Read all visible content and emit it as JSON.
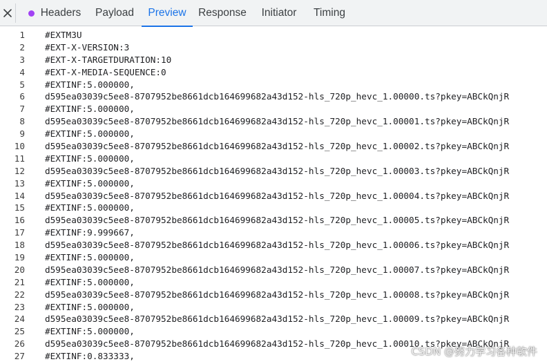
{
  "colors": {
    "accent": "#1a73e8",
    "headers_dot": "#a142f4",
    "tabbar_bg": "#f1f3f4"
  },
  "tabs": [
    {
      "label": "Headers",
      "icon": "status-dot-icon",
      "active": false
    },
    {
      "label": "Payload",
      "active": false
    },
    {
      "label": "Preview",
      "active": true
    },
    {
      "label": "Response",
      "active": false
    },
    {
      "label": "Initiator",
      "active": false
    },
    {
      "label": "Timing",
      "active": false
    }
  ],
  "lines": [
    {
      "n": "1",
      "t": "#EXTM3U"
    },
    {
      "n": "2",
      "t": "#EXT-X-VERSION:3"
    },
    {
      "n": "3",
      "t": "#EXT-X-TARGETDURATION:10"
    },
    {
      "n": "4",
      "t": "#EXT-X-MEDIA-SEQUENCE:0"
    },
    {
      "n": "5",
      "t": "#EXTINF:5.000000,"
    },
    {
      "n": "6",
      "t": "d595ea03039c5ee8-8707952be8661dcb164699682a43d152-hls_720p_hevc_1.00000.ts?pkey=ABCkQnjR"
    },
    {
      "n": "7",
      "t": "#EXTINF:5.000000,"
    },
    {
      "n": "8",
      "t": "d595ea03039c5ee8-8707952be8661dcb164699682a43d152-hls_720p_hevc_1.00001.ts?pkey=ABCkQnjR"
    },
    {
      "n": "9",
      "t": "#EXTINF:5.000000,"
    },
    {
      "n": "10",
      "t": "d595ea03039c5ee8-8707952be8661dcb164699682a43d152-hls_720p_hevc_1.00002.ts?pkey=ABCkQnjR"
    },
    {
      "n": "11",
      "t": "#EXTINF:5.000000,"
    },
    {
      "n": "12",
      "t": "d595ea03039c5ee8-8707952be8661dcb164699682a43d152-hls_720p_hevc_1.00003.ts?pkey=ABCkQnjR"
    },
    {
      "n": "13",
      "t": "#EXTINF:5.000000,"
    },
    {
      "n": "14",
      "t": "d595ea03039c5ee8-8707952be8661dcb164699682a43d152-hls_720p_hevc_1.00004.ts?pkey=ABCkQnjR"
    },
    {
      "n": "15",
      "t": "#EXTINF:5.000000,"
    },
    {
      "n": "16",
      "t": "d595ea03039c5ee8-8707952be8661dcb164699682a43d152-hls_720p_hevc_1.00005.ts?pkey=ABCkQnjR"
    },
    {
      "n": "17",
      "t": "#EXTINF:9.999667,"
    },
    {
      "n": "18",
      "t": "d595ea03039c5ee8-8707952be8661dcb164699682a43d152-hls_720p_hevc_1.00006.ts?pkey=ABCkQnjR"
    },
    {
      "n": "19",
      "t": "#EXTINF:5.000000,"
    },
    {
      "n": "20",
      "t": "d595ea03039c5ee8-8707952be8661dcb164699682a43d152-hls_720p_hevc_1.00007.ts?pkey=ABCkQnjR"
    },
    {
      "n": "21",
      "t": "#EXTINF:5.000000,"
    },
    {
      "n": "22",
      "t": "d595ea03039c5ee8-8707952be8661dcb164699682a43d152-hls_720p_hevc_1.00008.ts?pkey=ABCkQnjR"
    },
    {
      "n": "23",
      "t": "#EXTINF:5.000000,"
    },
    {
      "n": "24",
      "t": "d595ea03039c5ee8-8707952be8661dcb164699682a43d152-hls_720p_hevc_1.00009.ts?pkey=ABCkQnjR"
    },
    {
      "n": "25",
      "t": "#EXTINF:5.000000,"
    },
    {
      "n": "26",
      "t": "d595ea03039c5ee8-8707952be8661dcb164699682a43d152-hls_720p_hevc_1.00010.ts?pkey=ABCkQnjR"
    },
    {
      "n": "27",
      "t": "#EXTINF:0.833333,"
    }
  ],
  "watermark": "CSDN @努力学习各种软件"
}
